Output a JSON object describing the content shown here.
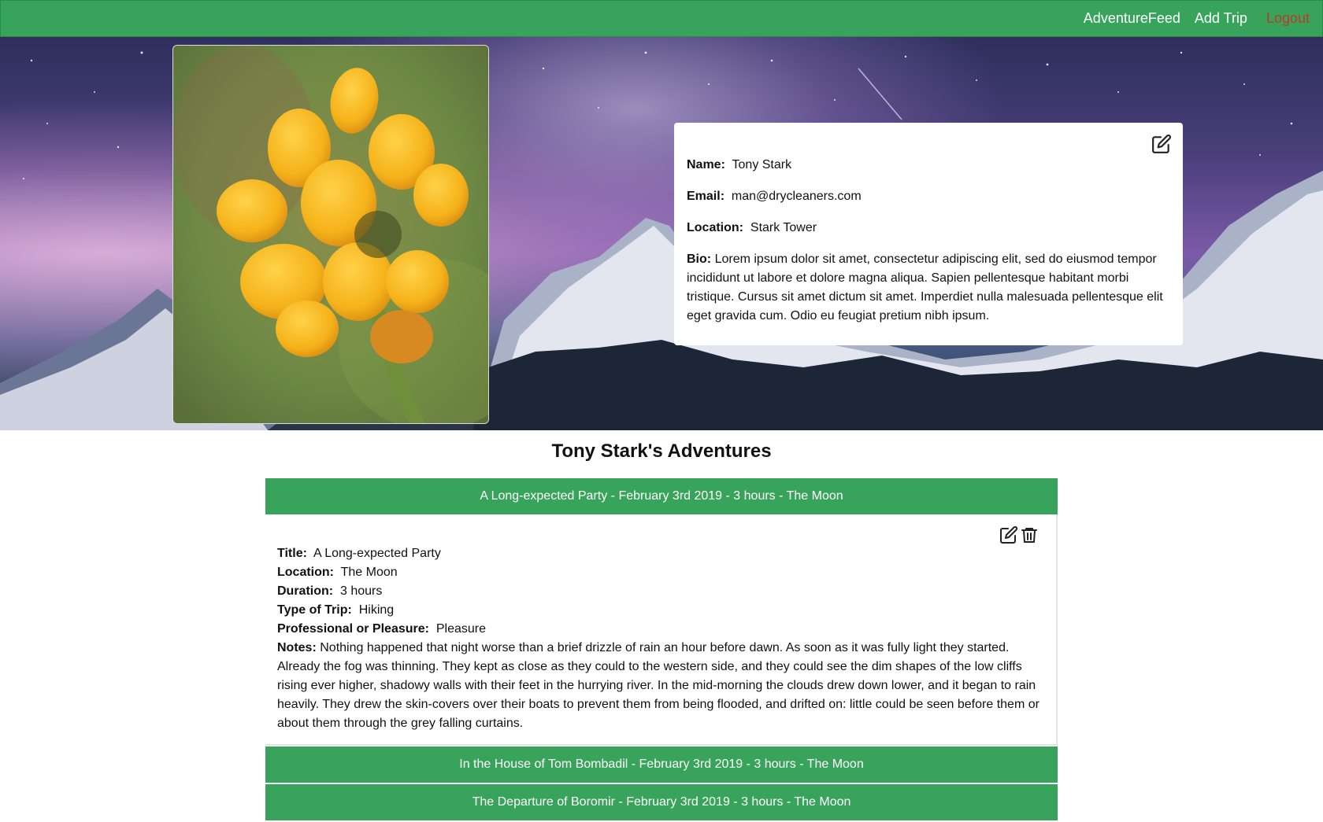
{
  "nav": {
    "feed": "AdventureFeed",
    "add_trip": "Add Trip",
    "logout": "Logout"
  },
  "profile": {
    "name_label": "Name:",
    "name": "Tony Stark",
    "email_label": "Email:",
    "email": "man@drycleaners.com",
    "location_label": "Location:",
    "location": "Stark Tower",
    "bio_label": "Bio:",
    "bio": "Lorem ipsum dolor sit amet, consectetur adipiscing elit, sed do eiusmod tempor incididunt ut labore et dolore magna aliqua. Sapien pellentesque habitant morbi tristique. Cursus sit amet dictum sit amet. Imperdiet nulla malesuada pellentesque elit eget gravida cum. Odio eu feugiat pretium nibh ipsum."
  },
  "adventures": {
    "heading": "Tony Stark's Adventures",
    "trips": [
      {
        "header": "A Long-expected Party - February 3rd 2019 - 3 hours - The Moon"
      },
      {
        "header": "In the House of Tom Bombadil - February 3rd 2019 - 3 hours - The Moon"
      },
      {
        "header": "The Departure of Boromir - February 3rd 2019 - 3 hours - The Moon"
      }
    ],
    "detail": {
      "title_label": "Title:",
      "title": "A Long-expected Party",
      "location_label": "Location:",
      "location": "The Moon",
      "duration_label": "Duration:",
      "duration": "3 hours",
      "type_label": "Type of Trip:",
      "type": "Hiking",
      "purpose_label": "Professional or Pleasure:",
      "purpose": "Pleasure",
      "notes_label": "Notes:",
      "notes": "Nothing happened that night worse than a brief drizzle of rain an hour before dawn. As soon as it was fully light they started. Already the fog was thinning. They kept as close as they could to the western side, and they could see the dim shapes of the low cliffs rising ever higher, shadowy walls with their feet in the hurrying river. In the mid-morning the clouds drew down lower, and it began to rain heavily. They drew the skin-covers over their boats to prevent them from being flooded, and drifted on: little could be seen before them or about them through the grey falling curtains."
    }
  },
  "colors": {
    "accent": "#38a35a",
    "logout": "#c0392b"
  },
  "icons": [
    "edit-icon",
    "trash-icon"
  ]
}
